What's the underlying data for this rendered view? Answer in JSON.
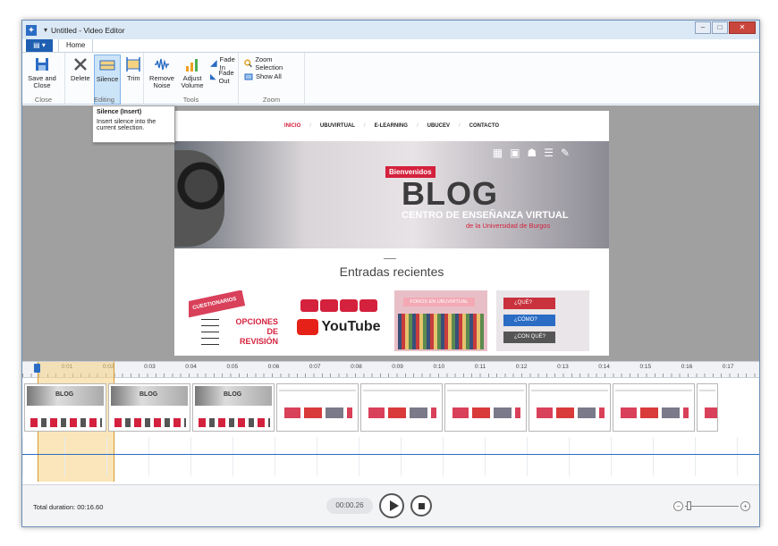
{
  "window": {
    "title": "Untitled - Video Editor",
    "quick_access": "▾"
  },
  "tabs": {
    "file": "▤ ▾",
    "home": "Home"
  },
  "ribbon": {
    "close_group": {
      "label": "Close",
      "save_close": "Save and Close"
    },
    "editing_group": {
      "label": "Editing",
      "delete": "Delete",
      "silence": "Silence",
      "trim": "Trim"
    },
    "tools_group": {
      "label": "Tools",
      "remove_noise": "Remove Noise",
      "adjust_volume": "Adjust Volume",
      "fade_in": "Fade In",
      "fade_out": "Fade Out"
    },
    "zoom_group": {
      "label": "Zoom",
      "zoom_selection": "Zoom Selection",
      "show_all": "Show All"
    }
  },
  "tooltip": {
    "title": "Silence (Insert)",
    "body": "Insert silence into the current selection."
  },
  "webpage": {
    "nav": [
      "INICIO",
      "UBUVIRTUAL",
      "E-LEARNING",
      "UBUCEV",
      "CONTACTO"
    ],
    "welcome": "Bienvenidos",
    "blog": "BLOG",
    "subtitle": "CENTRO DE ENSEÑANZA VIRTUAL",
    "subtitle2": "de la Universidad de Burgos",
    "recent": "Entradas recientes",
    "thumb1_banner": "CUESTIONARIOS",
    "thumb1_text": "OPCIONES DE REVISIÓN",
    "thumb2_text": "YouTube",
    "thumb3_text": "FOROS EN UBUVIRTUAL",
    "thumb4_q1": "¿QUÉ?",
    "thumb4_q2": "¿CÓMO?",
    "thumb4_q3": "¿CON QUÉ?"
  },
  "timeline": {
    "ticks": [
      "0:01",
      "0:02",
      "0:03",
      "0:04",
      "0:05",
      "0:06",
      "0:07",
      "0:08",
      "0:09",
      "0:10",
      "0:11",
      "0:12",
      "0:13",
      "0:14",
      "0:15",
      "0:16",
      "0:17"
    ]
  },
  "bottombar": {
    "duration": "Total duration: 00:16.60",
    "timecode": "00:00.26"
  },
  "colors": {
    "accent": "#2b6cc4",
    "selection": "#f5d282",
    "brand_red": "#d4213d"
  }
}
